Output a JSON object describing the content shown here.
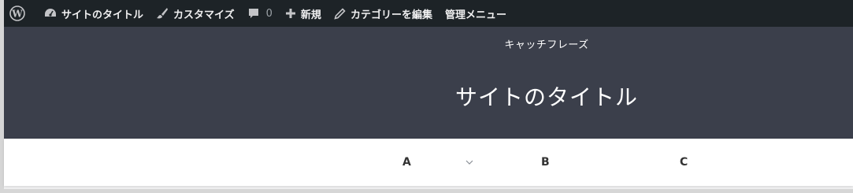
{
  "adminbar": {
    "wp_logo_icon": "wordpress-icon",
    "site_name": "サイトのタイトル",
    "customize": "カスタマイズ",
    "comments_count": "0",
    "new": "新規",
    "edit_category": "カテゴリーを編集",
    "admin_menu": "管理メニュー"
  },
  "header": {
    "tagline": "キャッチフレーズ",
    "title": "サイトのタイトル",
    "background": "#3b3f4b"
  },
  "nav": {
    "items": [
      {
        "label": "A",
        "has_submenu": true
      },
      {
        "label": "B",
        "has_submenu": false
      },
      {
        "label": "C",
        "has_submenu": false
      }
    ]
  },
  "colors": {
    "adminbar_bg": "#1d2327",
    "header_bg": "#3b3f4b",
    "nav_bg": "#ffffff"
  }
}
